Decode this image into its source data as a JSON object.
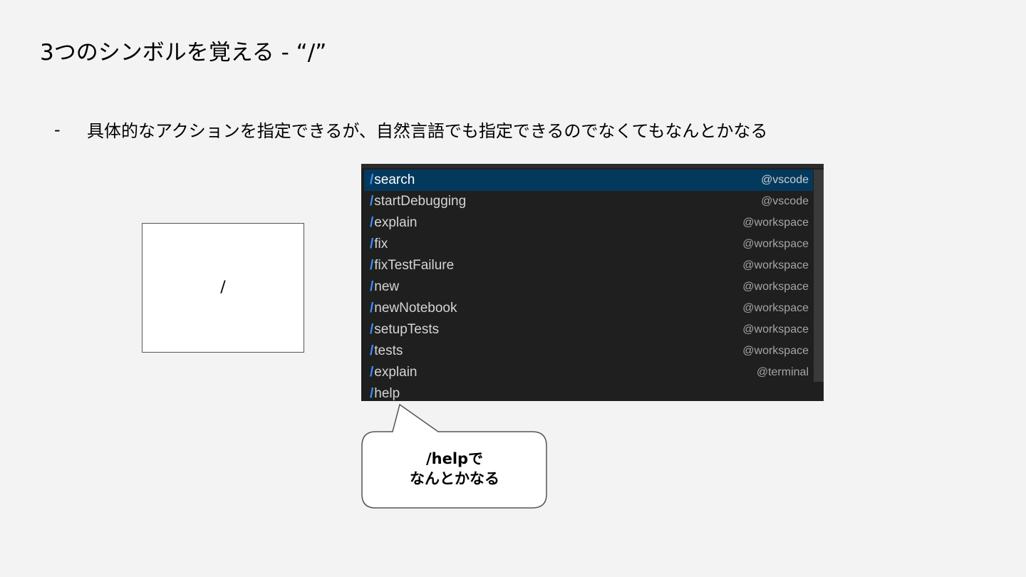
{
  "slide": {
    "title": "3つのシンボルを覚える - “/”",
    "bullet_dash": "-",
    "bullet_text": "具体的なアクションを指定できるが、自然言語でも指定できるのでなくてもなんとかなる",
    "symbol": "/"
  },
  "menu": {
    "items": [
      {
        "slash": "/",
        "command": "search",
        "agent": "@vscode",
        "selected": true
      },
      {
        "slash": "/",
        "command": "startDebugging",
        "agent": "@vscode"
      },
      {
        "slash": "/",
        "command": "explain",
        "agent": "@workspace"
      },
      {
        "slash": "/",
        "command": "fix",
        "agent": "@workspace"
      },
      {
        "slash": "/",
        "command": "fixTestFailure",
        "agent": "@workspace"
      },
      {
        "slash": "/",
        "command": "new",
        "agent": "@workspace"
      },
      {
        "slash": "/",
        "command": "newNotebook",
        "agent": "@workspace"
      },
      {
        "slash": "/",
        "command": "setupTests",
        "agent": "@workspace"
      },
      {
        "slash": "/",
        "command": "tests",
        "agent": "@workspace"
      },
      {
        "slash": "/",
        "command": "explain",
        "agent": "@terminal"
      },
      {
        "slash": "/",
        "command": "help",
        "agent": ""
      }
    ]
  },
  "callout": {
    "line1": "/helpで",
    "line2": "なんとかなる"
  },
  "colors": {
    "background": "#f3f3f3",
    "menu_bg": "#1f1f1f",
    "selected_bg": "#04395e",
    "slash_accent": "#3794ff"
  }
}
